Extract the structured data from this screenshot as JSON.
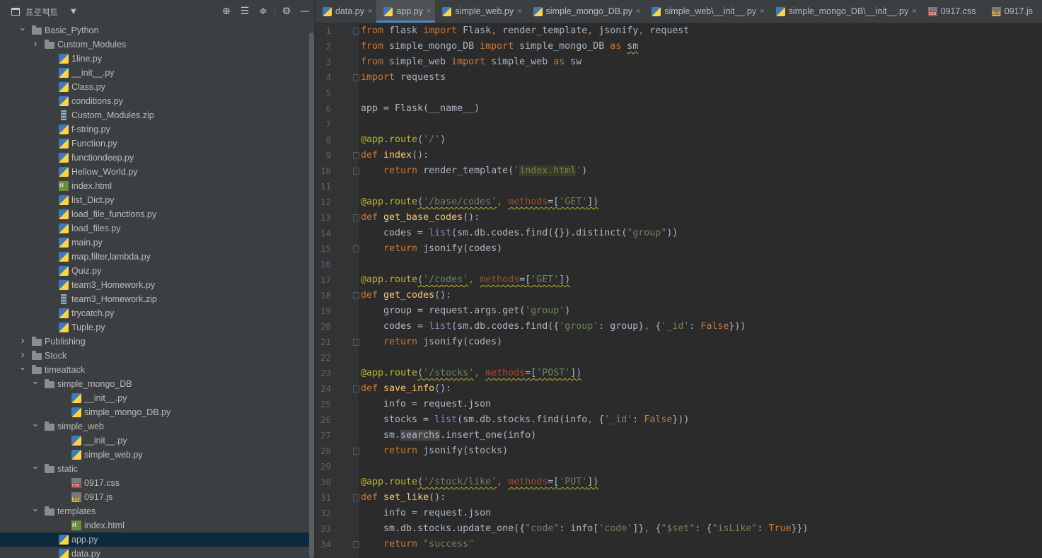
{
  "project_panel": {
    "title": "프로젝트",
    "tree": [
      {
        "label": "Basic_Python",
        "type": "folder",
        "depth": 1,
        "expanded": true
      },
      {
        "label": "Custom_Modules",
        "type": "folder",
        "depth": 2,
        "expanded": false
      },
      {
        "label": "1line.py",
        "type": "py",
        "depth": 2
      },
      {
        "label": "__init__.py",
        "type": "py",
        "depth": 2
      },
      {
        "label": "Class.py",
        "type": "py",
        "depth": 2
      },
      {
        "label": "conditions.py",
        "type": "py",
        "depth": 2
      },
      {
        "label": "Custom_Modules.zip",
        "type": "zip",
        "depth": 2
      },
      {
        "label": "f-string.py",
        "type": "py",
        "depth": 2
      },
      {
        "label": "Function.py",
        "type": "py",
        "depth": 2
      },
      {
        "label": "functiondeep.py",
        "type": "py",
        "depth": 2
      },
      {
        "label": "Hellow_World.py",
        "type": "py",
        "depth": 2
      },
      {
        "label": "index.html",
        "type": "html",
        "depth": 2
      },
      {
        "label": "list_Dict.py",
        "type": "py",
        "depth": 2
      },
      {
        "label": "load_file_functions.py",
        "type": "py",
        "depth": 2
      },
      {
        "label": "load_files.py",
        "type": "py",
        "depth": 2
      },
      {
        "label": "main.py",
        "type": "py",
        "depth": 2
      },
      {
        "label": "map,filter,lambda.py",
        "type": "py",
        "depth": 2
      },
      {
        "label": "Quiz.py",
        "type": "py",
        "depth": 2
      },
      {
        "label": "team3_Homework.py",
        "type": "py",
        "depth": 2
      },
      {
        "label": "team3_Homework.zip",
        "type": "zip",
        "depth": 2
      },
      {
        "label": "trycatch.py",
        "type": "py",
        "depth": 2
      },
      {
        "label": "Tuple.py",
        "type": "py",
        "depth": 2
      },
      {
        "label": "Publishing",
        "type": "folder",
        "depth": 1,
        "expanded": false
      },
      {
        "label": "Stock",
        "type": "folder",
        "depth": 1,
        "expanded": false
      },
      {
        "label": "timeattack",
        "type": "folder",
        "depth": 1,
        "expanded": true
      },
      {
        "label": "simple_mongo_DB",
        "type": "folder",
        "depth": 2,
        "expanded": true
      },
      {
        "label": "__init__.py",
        "type": "py",
        "depth": 3
      },
      {
        "label": "simple_mongo_DB.py",
        "type": "py",
        "depth": 3
      },
      {
        "label": "simple_web",
        "type": "folder",
        "depth": 2,
        "expanded": true
      },
      {
        "label": "__init__.py",
        "type": "py",
        "depth": 3
      },
      {
        "label": "simple_web.py",
        "type": "py",
        "depth": 3
      },
      {
        "label": "static",
        "type": "folder",
        "depth": 2,
        "expanded": true
      },
      {
        "label": "0917.css",
        "type": "css",
        "depth": 3
      },
      {
        "label": "0917.js",
        "type": "js",
        "depth": 3
      },
      {
        "label": "templates",
        "type": "folder",
        "depth": 2,
        "expanded": true
      },
      {
        "label": "index.html",
        "type": "html",
        "depth": 3
      },
      {
        "label": "app.py",
        "type": "py",
        "depth": 2,
        "selected": true
      },
      {
        "label": "data.py",
        "type": "py",
        "depth": 2
      }
    ]
  },
  "tabs": [
    {
      "label": "data.py",
      "type": "py",
      "active": false
    },
    {
      "label": "app.py",
      "type": "py",
      "active": true
    },
    {
      "label": "simple_web.py",
      "type": "py",
      "active": false
    },
    {
      "label": "simple_mongo_DB.py",
      "type": "py",
      "active": false
    },
    {
      "label": "simple_web\\__init__.py",
      "type": "py",
      "active": false
    },
    {
      "label": "simple_mongo_DB\\__init__.py",
      "type": "py",
      "active": false
    },
    {
      "label": "0917.css",
      "type": "css",
      "active": false
    },
    {
      "label": "0917.js",
      "type": "js",
      "active": false
    }
  ],
  "editor": {
    "lines": [
      [
        [
          "kw",
          "from "
        ],
        [
          "t",
          "flask "
        ],
        [
          "kw",
          "import "
        ],
        [
          "t",
          "Flask"
        ],
        [
          "kw",
          ", "
        ],
        [
          "t",
          "render_template"
        ],
        [
          "kw",
          ", "
        ],
        [
          "t",
          "jsonify"
        ],
        [
          "kw",
          ", "
        ],
        [
          "t",
          "request"
        ]
      ],
      [
        [
          "kw",
          "from "
        ],
        [
          "t",
          "simple_mongo_DB "
        ],
        [
          "kw",
          "import "
        ],
        [
          "t",
          "simple_mongo_DB "
        ],
        [
          "kw",
          "as "
        ],
        [
          "wavy",
          "sm"
        ]
      ],
      [
        [
          "kw",
          "from "
        ],
        [
          "t",
          "simple_web "
        ],
        [
          "kw",
          "import "
        ],
        [
          "t",
          "simple_web "
        ],
        [
          "kw",
          "as "
        ],
        [
          "t",
          "sw"
        ]
      ],
      [
        [
          "kw",
          "import "
        ],
        [
          "t",
          "requests"
        ]
      ],
      [],
      [
        [
          "t",
          "app = Flask(__name__)"
        ]
      ],
      [],
      [
        [
          "dec",
          "@app.route"
        ],
        [
          "t",
          "("
        ],
        [
          "str",
          "'/'"
        ],
        [
          "t",
          ")"
        ]
      ],
      [
        [
          "kw",
          "def "
        ],
        [
          "fn",
          "index"
        ],
        [
          "t",
          "():"
        ]
      ],
      [
        [
          "t",
          "    "
        ],
        [
          "kw",
          "return "
        ],
        [
          "t",
          "render_template("
        ],
        [
          "str",
          "'"
        ],
        [
          "hl",
          "index.html"
        ],
        [
          "str",
          "'"
        ],
        [
          "t",
          ")"
        ]
      ],
      [],
      [
        [
          "dec",
          "@app.route"
        ],
        [
          "t",
          "("
        ],
        [
          "str",
          "'/base/codes'"
        ],
        [
          "kw",
          ", "
        ],
        [
          "prm",
          "methods"
        ],
        [
          "t",
          "=["
        ],
        [
          "str",
          "'GET'"
        ],
        [
          "t",
          "])"
        ]
      ],
      [
        [
          "kw",
          "def "
        ],
        [
          "fn",
          "get_base_codes"
        ],
        [
          "t",
          "():"
        ]
      ],
      [
        [
          "t",
          "    codes = "
        ],
        [
          "bi",
          "list"
        ],
        [
          "t",
          "(sm.db.codes.find({}).distinct("
        ],
        [
          "str",
          "\"group\""
        ],
        [
          "t",
          "))"
        ]
      ],
      [
        [
          "t",
          "    "
        ],
        [
          "kw",
          "return "
        ],
        [
          "t",
          "jsonify(codes)"
        ]
      ],
      [],
      [
        [
          "dec",
          "@app.route"
        ],
        [
          "t",
          "("
        ],
        [
          "str",
          "'/codes'"
        ],
        [
          "kw",
          ", "
        ],
        [
          "prm",
          "methods"
        ],
        [
          "t",
          "=["
        ],
        [
          "str",
          "'GET'"
        ],
        [
          "t",
          "])"
        ]
      ],
      [
        [
          "kw",
          "def "
        ],
        [
          "fn",
          "get_codes"
        ],
        [
          "t",
          "():"
        ]
      ],
      [
        [
          "t",
          "    group = request.args.get("
        ],
        [
          "str",
          "'group'"
        ],
        [
          "t",
          ")"
        ]
      ],
      [
        [
          "t",
          "    codes = "
        ],
        [
          "bi",
          "list"
        ],
        [
          "t",
          "(sm.db.codes.find({"
        ],
        [
          "str",
          "'group'"
        ],
        [
          "t",
          ": group}"
        ],
        [
          "kw",
          ", "
        ],
        [
          "t",
          "{"
        ],
        [
          "str",
          "'_id'"
        ],
        [
          "t",
          ": "
        ],
        [
          "kw",
          "False"
        ],
        [
          "t",
          "}))"
        ]
      ],
      [
        [
          "t",
          "    "
        ],
        [
          "kw",
          "return "
        ],
        [
          "t",
          "jsonify(codes)"
        ]
      ],
      [],
      [
        [
          "dec",
          "@app.route"
        ],
        [
          "t",
          "("
        ],
        [
          "str",
          "'/stocks'"
        ],
        [
          "kw",
          ", "
        ],
        [
          "prm",
          "methods"
        ],
        [
          "t",
          "=["
        ],
        [
          "str",
          "'POST'"
        ],
        [
          "t",
          "])"
        ]
      ],
      [
        [
          "kw",
          "def "
        ],
        [
          "fn",
          "save_info"
        ],
        [
          "t",
          "():"
        ]
      ],
      [
        [
          "t",
          "    info = request.json"
        ]
      ],
      [
        [
          "t",
          "    stocks = "
        ],
        [
          "bi",
          "list"
        ],
        [
          "t",
          "(sm.db.stocks.find(info"
        ],
        [
          "kw",
          ", "
        ],
        [
          "t",
          "{"
        ],
        [
          "str",
          "'_id'"
        ],
        [
          "t",
          ": "
        ],
        [
          "kw",
          "False"
        ],
        [
          "t",
          "}))"
        ]
      ],
      [
        [
          "t",
          "    sm."
        ],
        [
          "hl2",
          "searchs"
        ],
        [
          "t",
          ".insert_one(info)"
        ]
      ],
      [
        [
          "t",
          "    "
        ],
        [
          "kw",
          "return "
        ],
        [
          "t",
          "jsonify(stocks)"
        ]
      ],
      [],
      [
        [
          "dec",
          "@app.route"
        ],
        [
          "t",
          "("
        ],
        [
          "str",
          "'/stock/like'"
        ],
        [
          "kw",
          ", "
        ],
        [
          "prm",
          "methods"
        ],
        [
          "t",
          "=["
        ],
        [
          "str",
          "'PUT'"
        ],
        [
          "t",
          "])"
        ]
      ],
      [
        [
          "kw",
          "def "
        ],
        [
          "fn",
          "set_like"
        ],
        [
          "t",
          "():"
        ]
      ],
      [
        [
          "t",
          "    info = request.json"
        ]
      ],
      [
        [
          "t",
          "    sm.db.stocks.update_one({"
        ],
        [
          "str",
          "\"code\""
        ],
        [
          "t",
          ": info["
        ],
        [
          "str",
          "'code'"
        ],
        [
          "t",
          "]}"
        ],
        [
          "kw",
          ", "
        ],
        [
          "t",
          "{"
        ],
        [
          "str",
          "\"$set\""
        ],
        [
          "t",
          ": {"
        ],
        [
          "str",
          "\"isLike\""
        ],
        [
          "t",
          ": "
        ],
        [
          "kw",
          "True"
        ],
        [
          "t",
          "}})"
        ]
      ],
      [
        [
          "t",
          "    "
        ],
        [
          "kw",
          "return "
        ],
        [
          "str",
          "\"success\""
        ]
      ]
    ],
    "wavy_lines": [
      12,
      17,
      23,
      30
    ],
    "fold_markers": [
      1,
      4,
      9,
      10,
      13,
      15,
      18,
      21,
      24,
      28,
      31,
      34
    ]
  }
}
